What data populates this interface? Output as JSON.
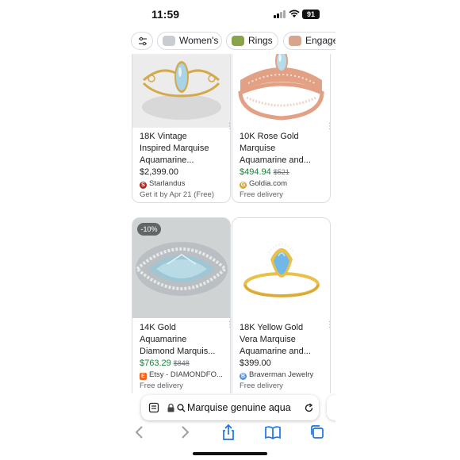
{
  "status": {
    "time": "11:59",
    "battery": "91"
  },
  "chips": [
    {
      "label": "",
      "icon": "sliders-icon"
    },
    {
      "label": "Women's",
      "icon": "ring-thumbnail",
      "color": "#c9ccd1"
    },
    {
      "label": "Rings",
      "icon": "ring-thumbnail",
      "color": "#8aa44a"
    },
    {
      "label": "Engagem",
      "icon": "ring-thumbnail",
      "color": "#d9a48a"
    }
  ],
  "products": [
    {
      "title_lines": [
        "18K Vintage",
        "Inspired Marquise",
        "Aquamarine..."
      ],
      "price": "$2,399.00",
      "old_price": "",
      "merchant": "Starlandus",
      "merchant_icon_color": "#b3261e",
      "shipping": "Get it by Apr 21 (Free)",
      "badge": ""
    },
    {
      "title_lines": [
        "10K Rose Gold",
        "Marquise",
        "Aquamarine and..."
      ],
      "price": "$494.94",
      "old_price": "$521",
      "merchant": "Goldia.com",
      "merchant_icon_color": "#e0a32c",
      "shipping": "Free delivery",
      "badge": ""
    },
    {
      "title_lines": [
        "14K Gold",
        "Aquamarine",
        "Diamond Marquis..."
      ],
      "price": "$763.29",
      "old_price": "$848",
      "merchant": "Etsy - DIAMONDFO...",
      "merchant_icon_color": "#f1641e",
      "shipping": "Free delivery",
      "badge": "-10%"
    },
    {
      "title_lines": [
        "18K Yellow Gold",
        "Vera Marquise",
        "Aquamarine and..."
      ],
      "price": "$399.00",
      "old_price": "",
      "merchant": "Braverman Jewelry",
      "merchant_icon_color": "#5b8fd6",
      "shipping": "Free delivery",
      "badge": ""
    }
  ],
  "address_bar": {
    "text": "Marquise genuine aqua"
  },
  "toolbar": [
    "back-icon",
    "forward-icon",
    "share-icon",
    "bookmarks-icon",
    "tabs-icon"
  ],
  "colors": {
    "sale_green": "#188038",
    "accent_blue": "#1a73e8"
  }
}
